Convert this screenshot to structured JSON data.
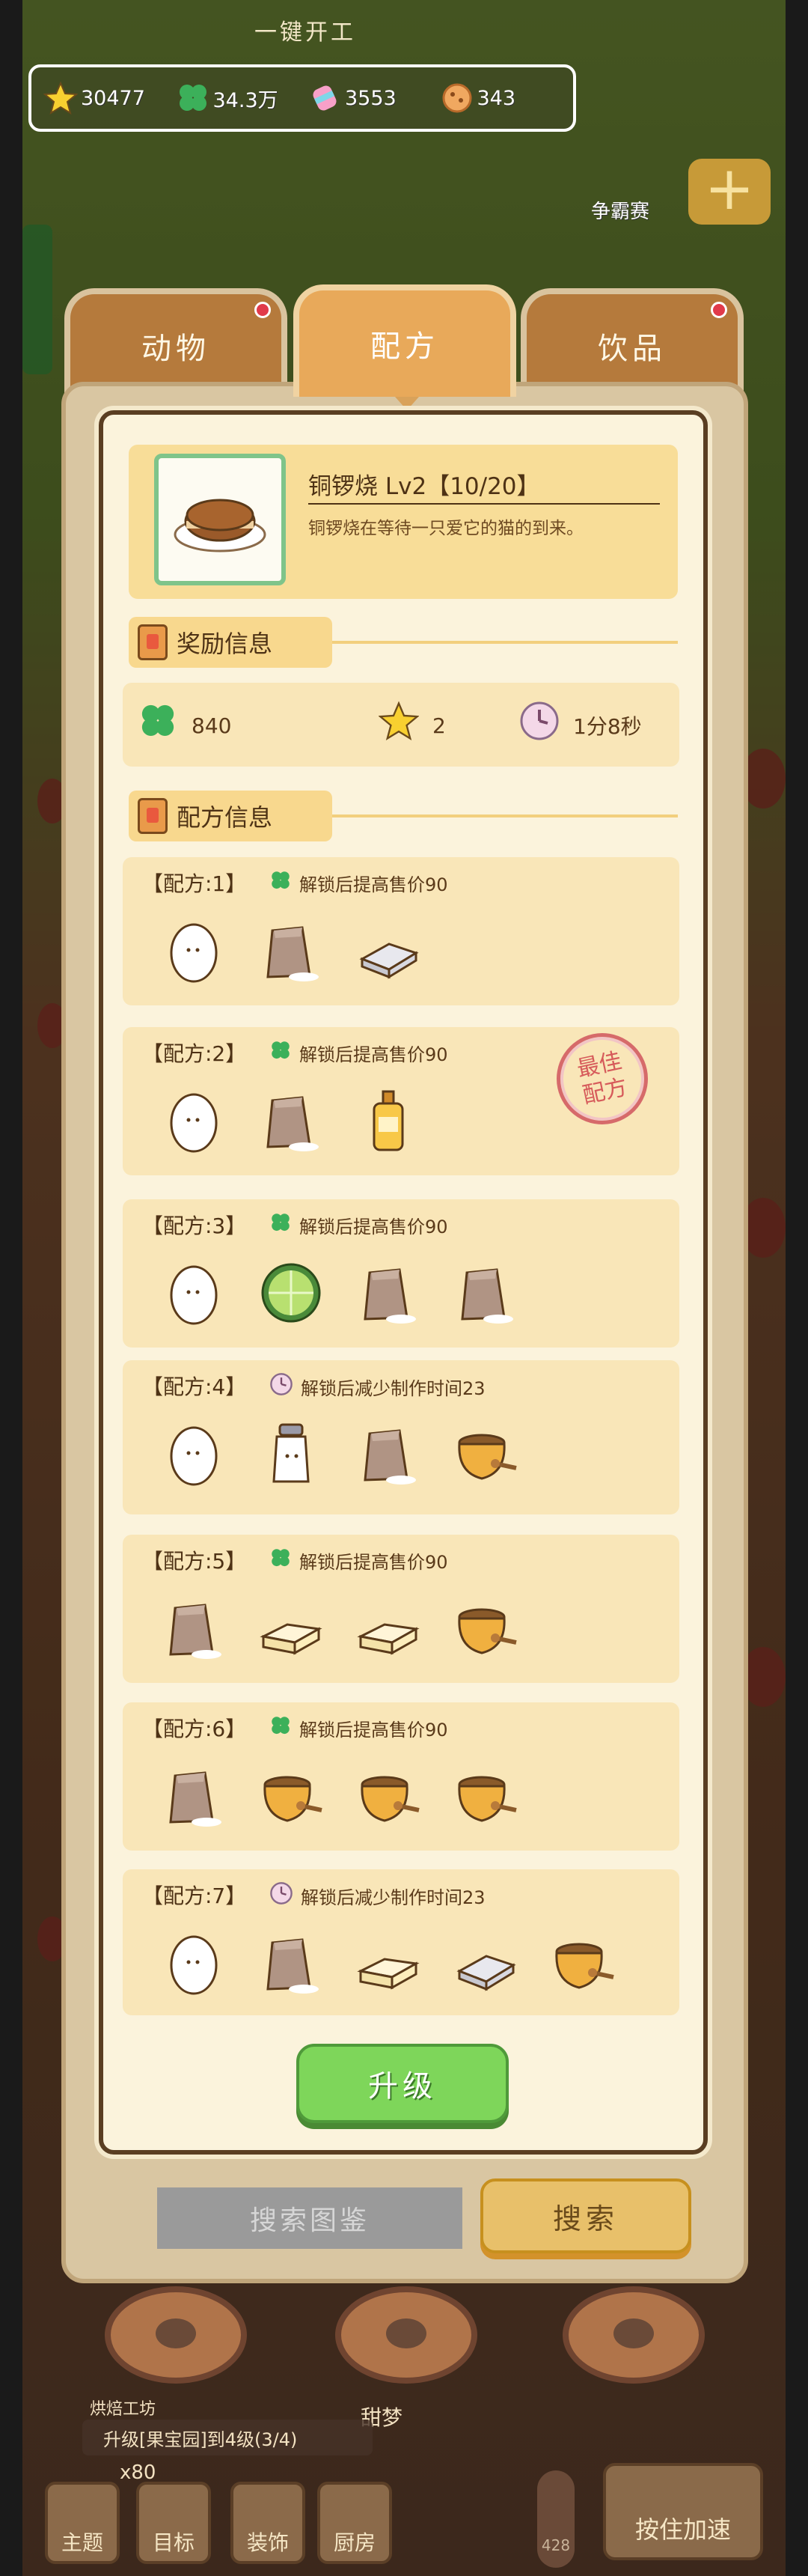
{
  "top_label": "一键开工",
  "resources": [
    {
      "icon": "star-icon",
      "value": "30477"
    },
    {
      "icon": "clover-icon",
      "value": "34.3万"
    },
    {
      "icon": "candy-icon",
      "value": "3553"
    },
    {
      "icon": "cookie-icon",
      "value": "343"
    }
  ],
  "rank_label": "争霸赛",
  "tabs": [
    {
      "label": "动物",
      "badge": true
    },
    {
      "label": "配方",
      "active": true
    },
    {
      "label": "饮品",
      "badge": true
    }
  ],
  "header": {
    "title": "铜锣烧 Lv2【10/20】",
    "desc": "铜锣烧在等待一只爱它的猫的到来。"
  },
  "reward_section": {
    "title": "奖励信息"
  },
  "rewards": {
    "clover": "840",
    "star": "2",
    "time": "1分8秒"
  },
  "recipe_section": {
    "title": "配方信息"
  },
  "recipes": [
    {
      "label": "【配方:1】",
      "hint_icon": "clover-icon",
      "hint": "解锁后提高售价90",
      "ingredients": [
        "egg",
        "flour",
        "butter"
      ]
    },
    {
      "label": "【配方:2】",
      "hint_icon": "clover-icon",
      "hint": "解锁后提高售价90",
      "ingredients": [
        "egg",
        "flour",
        "oil"
      ],
      "best": "最佳\n配方"
    },
    {
      "label": "【配方:3】",
      "hint_icon": "clover-icon",
      "hint": "解锁后提高售价90",
      "ingredients": [
        "egg",
        "lime",
        "flour",
        "flour"
      ]
    },
    {
      "label": "【配方:4】",
      "hint_icon": "clock-icon",
      "hint": "解锁后减少制作时间23",
      "ingredients": [
        "egg",
        "milk",
        "flour",
        "honey"
      ]
    },
    {
      "label": "【配方:5】",
      "hint_icon": "clover-icon",
      "hint": "解锁后提高售价90",
      "ingredients": [
        "flour",
        "butter-block",
        "butter-block",
        "honey"
      ]
    },
    {
      "label": "【配方:6】",
      "hint_icon": "clover-icon",
      "hint": "解锁后提高售价90",
      "ingredients": [
        "flour",
        "honey",
        "honey",
        "honey"
      ]
    },
    {
      "label": "【配方:7】",
      "hint_icon": "clock-icon",
      "hint": "解锁后减少制作时间23",
      "ingredients": [
        "egg",
        "flour",
        "butter-block",
        "butter",
        "honey"
      ]
    }
  ],
  "upgrade_label": "升级",
  "search": {
    "placeholder": "搜索图鉴",
    "button": "搜索"
  },
  "bottom": {
    "zone_label": "烘焙工坊",
    "quest": "升级[果宝园]到4级(3/4)",
    "count": "x80",
    "dessert": "甜梦",
    "thermo": "428",
    "buttons": [
      "主题",
      "目标",
      "装饰",
      "厨房"
    ],
    "hold": "按住加速"
  }
}
